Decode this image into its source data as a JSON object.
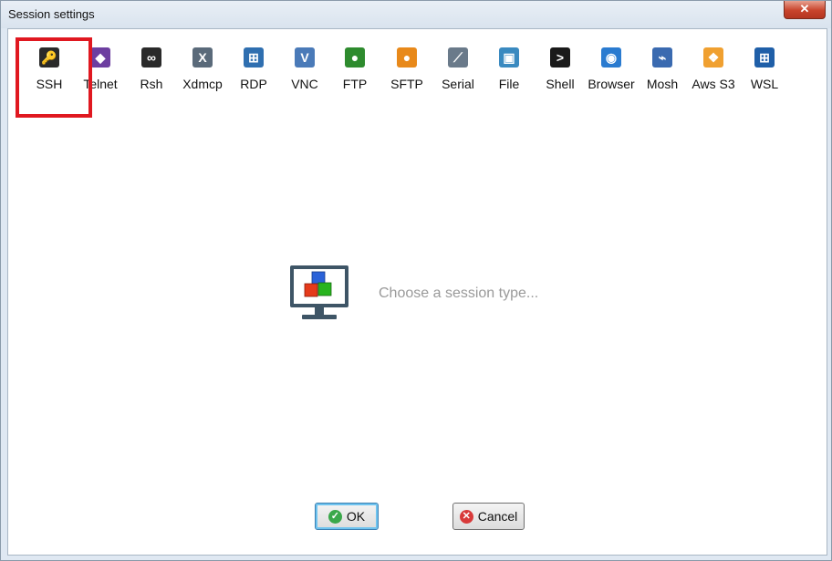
{
  "window": {
    "title": "Session settings",
    "close_label": "✕"
  },
  "toolbar": {
    "items": [
      {
        "label": "SSH",
        "icon": "ssh-key-icon",
        "color": "#2a2a2a",
        "glyph": "🔑"
      },
      {
        "label": "Telnet",
        "icon": "telnet-icon",
        "color": "#6d3fa0",
        "glyph": "◆"
      },
      {
        "label": "Rsh",
        "icon": "rsh-icon",
        "color": "#2a2a2a",
        "glyph": "∞"
      },
      {
        "label": "Xdmcp",
        "icon": "xdmcp-icon",
        "color": "#5a6a7a",
        "glyph": "X"
      },
      {
        "label": "RDP",
        "icon": "rdp-icon",
        "color": "#2f6fb0",
        "glyph": "⊞"
      },
      {
        "label": "VNC",
        "icon": "vnc-icon",
        "color": "#4a7ab8",
        "glyph": "V"
      },
      {
        "label": "FTP",
        "icon": "ftp-icon",
        "color": "#2e8b2e",
        "glyph": "●"
      },
      {
        "label": "SFTP",
        "icon": "sftp-icon",
        "color": "#e8891a",
        "glyph": "●"
      },
      {
        "label": "Serial",
        "icon": "serial-icon",
        "color": "#6a7a8a",
        "glyph": "⟋"
      },
      {
        "label": "File",
        "icon": "file-icon",
        "color": "#3a8ac0",
        "glyph": "▣"
      },
      {
        "label": "Shell",
        "icon": "shell-icon",
        "color": "#1a1a1a",
        "glyph": ">"
      },
      {
        "label": "Browser",
        "icon": "browser-icon",
        "color": "#2a7bd0",
        "glyph": "◉"
      },
      {
        "label": "Mosh",
        "icon": "mosh-icon",
        "color": "#3a6ab0",
        "glyph": "⌁"
      },
      {
        "label": "Aws S3",
        "icon": "aws-s3-icon",
        "color": "#f0a030",
        "glyph": "❖"
      },
      {
        "label": "WSL",
        "icon": "wsl-icon",
        "color": "#1f5fa8",
        "glyph": "⊞"
      }
    ]
  },
  "main": {
    "placeholder": "Choose a session type..."
  },
  "buttons": {
    "ok_label": "OK",
    "cancel_label": "Cancel"
  }
}
